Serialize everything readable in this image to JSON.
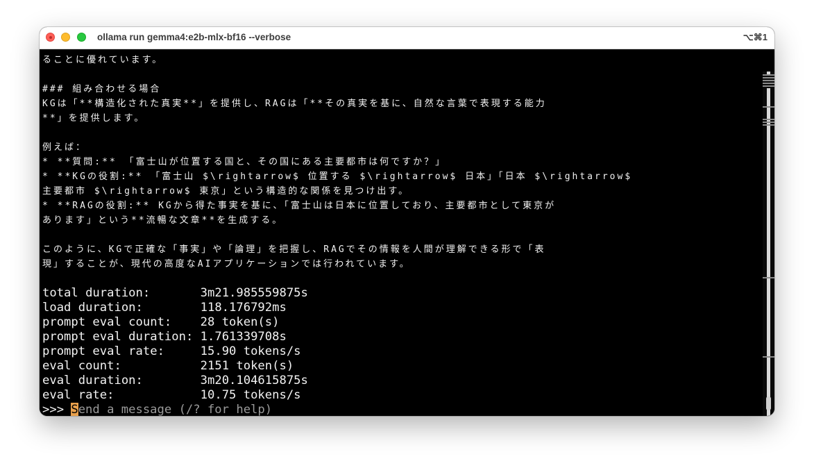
{
  "window": {
    "title": "ollama run gemma4:e2b-mlx-bf16 --verbose",
    "shortcut": "⌥⌘1"
  },
  "terminal": {
    "lines": [
      "ることに優れています。",
      "",
      "### 組み合わせる場合",
      "KGは「**構造化された真実**」を提供し、RAGは「**その真実を基に、自然な言葉で表現する能力",
      "**」を提供します。",
      "",
      "例えば：",
      "* **質問:** 「富士山が位置する国と、その国にある主要都市は何ですか？」",
      "* **KGの役割:** 「富士山 $\\rightarrow$ 位置する $\\rightarrow$ 日本」「日本 $\\rightarrow$",
      "主要都市 $\\rightarrow$ 東京」という構造的な関係を見つけ出す。",
      "* **RAGの役割:** KGから得た事実を基に、「富士山は日本に位置しており、主要都市として東京が",
      "あります」という**流暢な文章**を生成する。",
      "",
      "このように、KGで正確な「事実」や「論理」を把握し、RAGでその情報を人間が理解できる形で「表",
      "現」することが、現代の高度なAIアプリケーションでは行われています。",
      "",
      "total duration:       3m21.985559875s",
      "load duration:        118.176792ms",
      "prompt eval count:    28 token(s)",
      "prompt eval duration: 1.761339708s",
      "prompt eval rate:     15.90 tokens/s",
      "eval count:           2151 token(s)",
      "eval duration:        3m20.104615875s",
      "eval rate:            10.75 tokens/s"
    ],
    "prompt": ">>> ",
    "cursor_char": "S",
    "placeholder_rest": "end a message (/? for help)"
  },
  "colors": {
    "cursor": "#e8a04c",
    "close": "#ff5f57",
    "minimize": "#febc2e",
    "maximize": "#28c840"
  }
}
